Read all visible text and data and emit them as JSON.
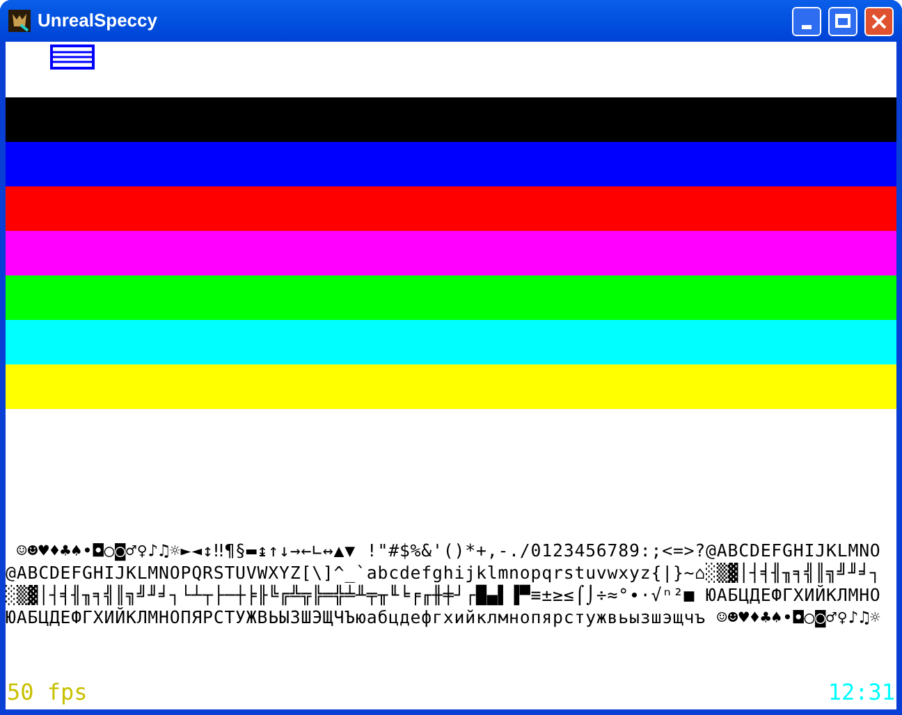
{
  "window": {
    "title": "UnrealSpeccy"
  },
  "stripes": [
    {
      "color": "#000000"
    },
    {
      "color": "#0000ff"
    },
    {
      "color": "#ff0000"
    },
    {
      "color": "#ff00ff"
    },
    {
      "color": "#00ff00"
    },
    {
      "color": "#00ffff"
    },
    {
      "color": "#ffff00"
    }
  ],
  "char_rows": [
    " ☺☻♥♦♣♠•◘○◙♂♀♪♫☼►◄↕‼¶§▬↨↑↓→←∟↔▲▼ !\"#$%&'()*+,-./0123456789:;<=>?@ABCDEFGHIJKLMNO",
    "@ABCDEFGHIJKLMNOPQRSTUVWXYZ[\\]^_`abcdefghijklmnopqrstuvwxyz{|}~⌂░▒▓│┤╡╢╖╕╣║╗╝╜╛┐",
    "░▒▓│┤╡╢╖╕╣║╗╝╜╛┐└┴┬├─┼╞╟╚╔╩╦╠═╬╧╨╤╥╙╘╒╓╫╪┘┌█▄▌▐▀≡±≥≤⌠⌡÷≈°∙·√ⁿ²■ ЮАБЦДЕФГХИЙКЛМНО",
    "ЮАБЦДЕФГХИЙКЛМНОПЯРСТУЖВЬЫЗШЭЩЧЪюабцдефгхийклмнопярстужвьызшэщчъ ☺☻♥♦♣♠•◘○◙♂♀♪♫☼"
  ],
  "status": {
    "fps": "50 fps",
    "clock": "12:31"
  }
}
